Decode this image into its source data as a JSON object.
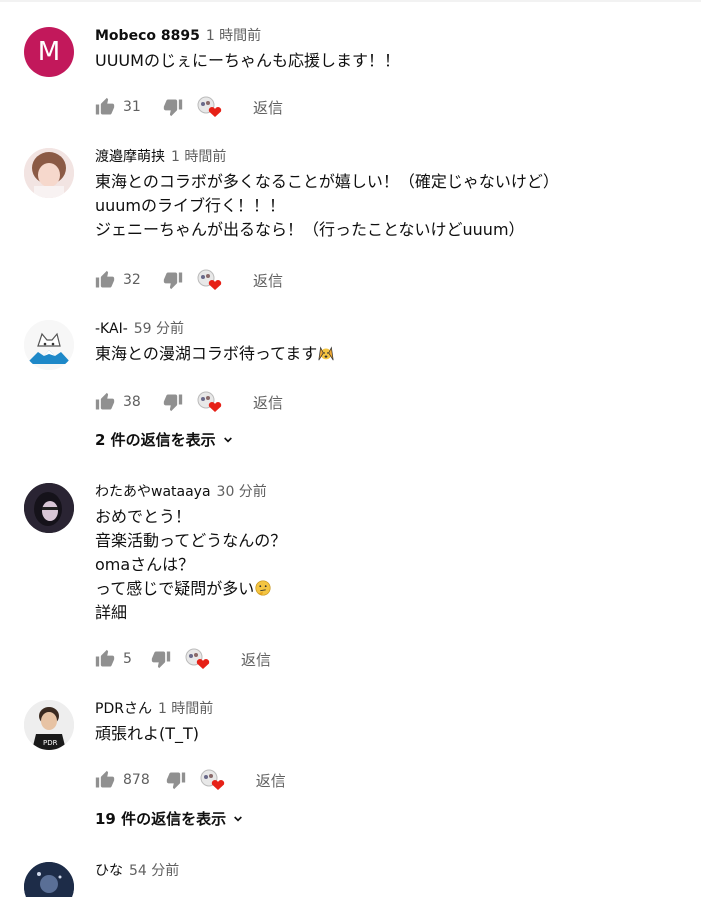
{
  "comments": [
    {
      "author": "Mobeco 8895",
      "time": "1 時間前",
      "avatar_letter": "M",
      "lines": [
        "UUUMのじぇにーちゃんも応援します！！"
      ],
      "likes": "31",
      "reply_label": "返信"
    },
    {
      "author": "渡邉摩萌挟",
      "time": "1 時間前",
      "lines": [
        "東海とのコラボが多くなることが嬉しい！（確定じゃないけど）",
        "uuumのライブ行く！！！",
        "ジェニーちゃんが出るなら！（行ったことないけどuuum）"
      ],
      "likes": "32",
      "reply_label": "返信"
    },
    {
      "author": "-KAI-",
      "time": "59 分前",
      "lines": [
        "東海との漫湖コラボ待ってます"
      ],
      "likes": "38",
      "reply_label": "返信",
      "replies_label": "2 件の返信を表示"
    },
    {
      "author": "わたあやwataaya",
      "time": "30 分前",
      "lines": [
        "おめでとう！",
        "音楽活動ってどうなんの？",
        "omaさんは？",
        "って感じで疑問が多い",
        "詳細"
      ],
      "likes": "5",
      "reply_label": "返信"
    },
    {
      "author": "PDRさん",
      "time": "1 時間前",
      "lines": [
        "頑張れよ(T_T)"
      ],
      "likes": "878",
      "reply_label": "返信",
      "replies_label": "19 件の返信を表示"
    },
    {
      "author": "ひな",
      "time": "54 分前",
      "lines": []
    }
  ],
  "icons": {
    "like": "thumb-up-icon",
    "dislike": "thumb-down-icon",
    "creator_heart": "creator-heart-icon",
    "expand": "chevron-down-icon"
  },
  "colors": {
    "heart": "#e62117",
    "avatar_m": "#c2185b",
    "secondary_text": "#606060"
  }
}
